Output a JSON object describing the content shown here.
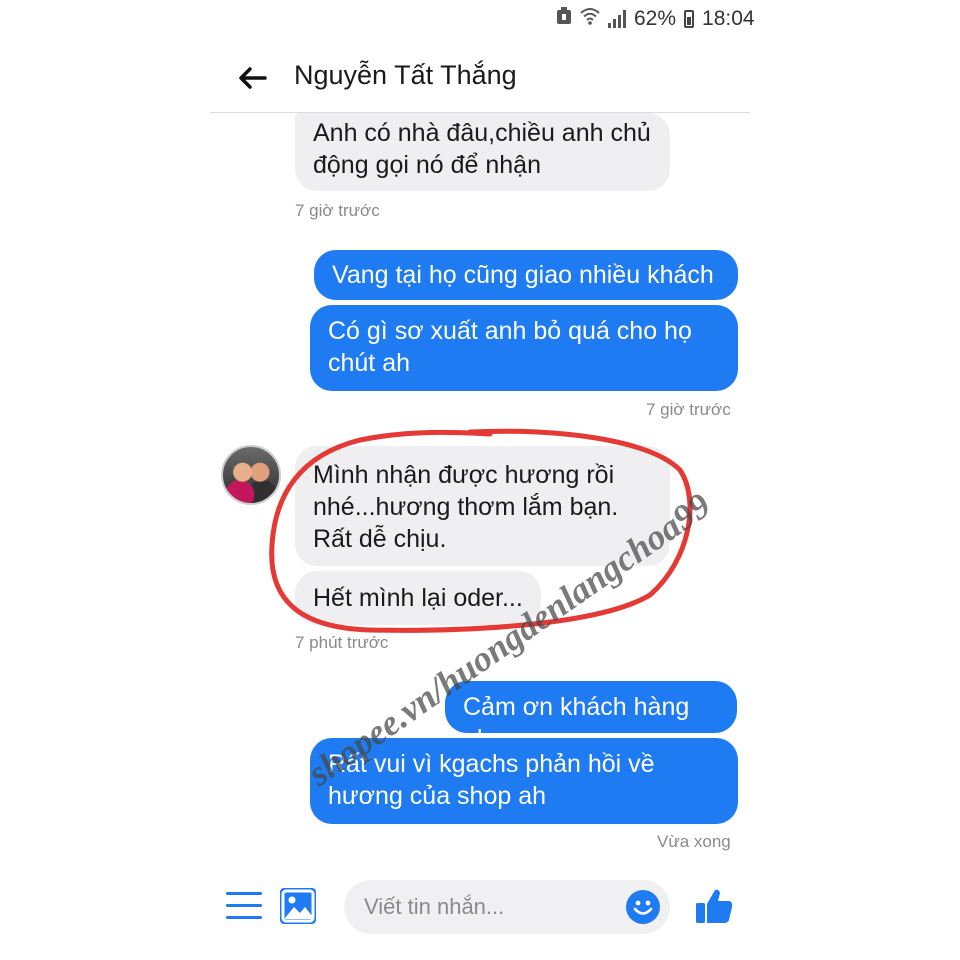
{
  "status_bar": {
    "battery": "62%",
    "time": "18:04"
  },
  "header": {
    "contact_name": "Nguyễn Tất Thắng"
  },
  "messages": [
    {
      "side": "in",
      "lines": [
        "Anh có nhà đâu,chiều anh chủ",
        "động gọi nó để nhận"
      ]
    },
    {
      "side": "out",
      "lines": [
        "Vang tại họ cũng giao nhiều khách"
      ]
    },
    {
      "side": "out",
      "lines": [
        "Có gì sơ xuất anh bỏ quá cho họ",
        "chút ah"
      ]
    },
    {
      "side": "in",
      "lines": [
        "Mình nhận được hương rồi",
        "nhé...hương thơm lắm bạn.",
        "Rất dễ chịu."
      ]
    },
    {
      "side": "in",
      "lines": [
        "Hết mình lại oder..."
      ]
    },
    {
      "side": "out",
      "lines": [
        "Cảm ơn khách hàng ah"
      ]
    },
    {
      "side": "out",
      "lines": [
        "Rất vui vì kgachs phản hồi về",
        "hương của shop ah"
      ]
    }
  ],
  "timestamps": [
    "7 giờ trước",
    "7 giờ trước",
    "7 phút trước",
    "Vừa xong"
  ],
  "watermark": "shopee.vn/huongdenlangchoa99",
  "composer": {
    "placeholder": "Viết tin nhắn..."
  },
  "colors": {
    "accent": "#1f7bf2",
    "incoming_bubble": "#efeff1",
    "highlight_ring": "#e53935"
  },
  "icons": {
    "back": "arrow-left-icon",
    "menu": "menu-icon",
    "image": "image-icon",
    "emoji": "emoji-icon",
    "like": "thumbs-up-icon"
  }
}
